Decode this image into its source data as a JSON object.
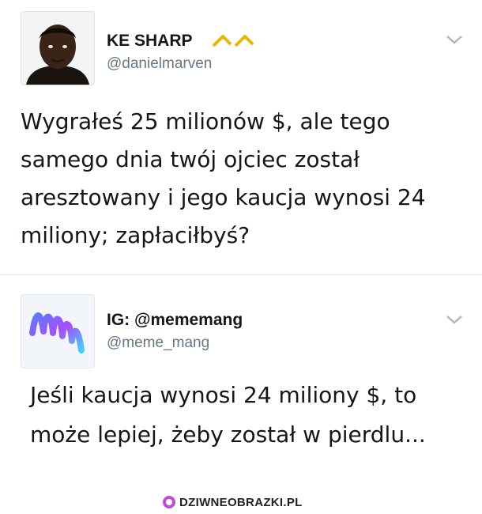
{
  "tweets": [
    {
      "display_name": "KE SHARP",
      "handle": "@danielmarven",
      "text": "Wygrałeś 25 milionów $, ale tego samego dnia twój ojciec został aresztowany i jego kaucja wynosi 24 miliony; zapłaciłbyś?",
      "badge_icon": "crown-logo-icon",
      "badge_color": "#e8b800"
    },
    {
      "display_name": "IG: @mememang",
      "handle": "@meme_mang",
      "text": "Jeśli kaucja wynosi 24 miliony $, to może lepiej, żeby został w pierdlu...",
      "avatar_icon": "mm-logo-icon"
    }
  ],
  "watermark": {
    "text": "DZIWNEOBRAZKI.PL",
    "color": "#c04bd6"
  },
  "colors": {
    "text": "#14171a",
    "secondary": "#657786",
    "divider": "#e6ecf0"
  }
}
